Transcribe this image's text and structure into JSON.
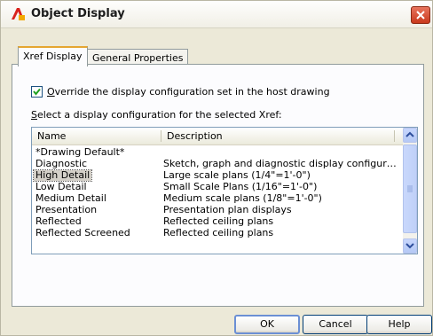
{
  "window": {
    "title": "Object Display"
  },
  "tabs": [
    {
      "label": "Xref Display",
      "active": true
    },
    {
      "label": "General Properties",
      "active": false
    }
  ],
  "override": {
    "checked": true,
    "label_mnemonic": "O",
    "label_rest": "verride the display configuration set in the host drawing"
  },
  "select_label": {
    "mnemonic": "S",
    "rest": "elect a display configuration for the selected Xref:"
  },
  "list": {
    "columns": [
      "Name",
      "Description"
    ],
    "rows": [
      {
        "name": "*Drawing Default*",
        "description": ""
      },
      {
        "name": "Diagnostic",
        "description": "Sketch, graph and diagnostic display configur…"
      },
      {
        "name": "High Detail",
        "description": "Large scale plans (1/4\"=1'-0\")",
        "selected": true
      },
      {
        "name": "Low Detail",
        "description": "Small Scale Plans (1/16\"=1'-0\")"
      },
      {
        "name": "Medium Detail",
        "description": "Medium scale plans (1/8\"=1'-0\")"
      },
      {
        "name": "Presentation",
        "description": "Presentation plan displays"
      },
      {
        "name": "Reflected",
        "description": "Reflected ceiling plans"
      },
      {
        "name": "Reflected Screened",
        "description": "Reflected ceiling plans"
      }
    ]
  },
  "buttons": {
    "ok": "OK",
    "cancel": "Cancel",
    "help": "Help"
  },
  "colors": {
    "titlebar_close": "#c9391c",
    "selection": "#d4d0c8",
    "tab_highlight": "#e5a631"
  }
}
